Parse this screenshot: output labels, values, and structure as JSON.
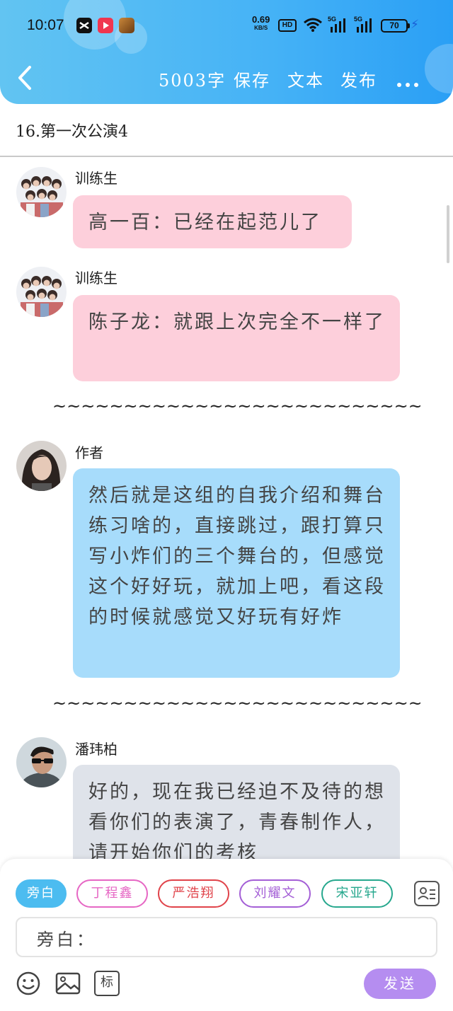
{
  "status_bar": {
    "time": "10:07",
    "net_speed": "0.69",
    "net_unit": "KB/S",
    "hd": "HD",
    "sim1": "5G",
    "sim2": "5G",
    "battery": "70"
  },
  "toolbar": {
    "word_count": "5003字",
    "save": "保存",
    "text": "文本",
    "publish": "发布"
  },
  "chapter_title": "16.第一次公演4",
  "messages": [
    {
      "sender": "训练生",
      "text": "高一百：已经在起范儿了",
      "style": "pink",
      "avatar": "group-avatar"
    },
    {
      "sender": "训练生",
      "text": "陈子龙：就跟上次完全不一样了",
      "style": "pink",
      "avatar": "group-avatar"
    },
    {
      "sender": "作者",
      "text": "然后就是这组的自我介绍和舞台练习啥的，直接跳过，跟打算只写小炸们的三个舞台的，但感觉这个好好玩，就加上吧，看这段的时候就感觉又好玩有好炸",
      "style": "blue",
      "avatar": "author-avatar"
    },
    {
      "sender": "潘玮柏",
      "text": "好的，现在我已经迫不及待的想看你们的表演了，青春制作人，请开始你们的考核",
      "style": "grey",
      "avatar": "person-avatar"
    }
  ],
  "separator": "~~~~~~~~~~~~~~~~~~~~~~~~~~~~~~~~~~",
  "characters": [
    {
      "label": "旁白",
      "color": "#4cbcf0",
      "filled": true
    },
    {
      "label": "丁程鑫",
      "color": "#e667c4",
      "filled": false
    },
    {
      "label": "严浩翔",
      "color": "#e0434a",
      "filled": false
    },
    {
      "label": "刘耀文",
      "color": "#a45fd6",
      "filled": false
    },
    {
      "label": "宋亚轩",
      "color": "#27a88e",
      "filled": false
    }
  ],
  "input": {
    "label": "旁白："
  },
  "send_label": "发送",
  "tools": {
    "tag_label": "标"
  }
}
